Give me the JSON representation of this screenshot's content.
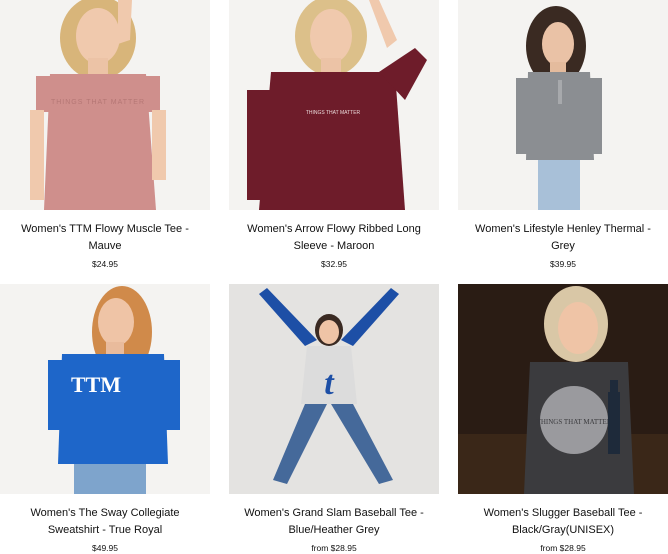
{
  "products": [
    {
      "title": "Women's TTM Flowy Muscle Tee - Mauve",
      "price": "$24.95",
      "shirt_color": "#cf8f8c",
      "shirt_print": "THINGS THAT MATTER",
      "bg": "#f3f2f0"
    },
    {
      "title": "Women's Arrow Flowy Ribbed Long Sleeve - Maroon",
      "price": "$32.95",
      "shirt_color": "#6e1c2a",
      "shirt_print": "THINGS THAT MATTER",
      "bg": "#f3f2f0"
    },
    {
      "title": "Women's Lifestyle Henley Thermal - Grey",
      "price": "$39.95",
      "shirt_color": "#8b8e92",
      "shirt_print": "",
      "bg": "#f3f2f0"
    },
    {
      "title": "Women's The Sway Collegiate Sweatshirt - True Royal",
      "price": "$49.95",
      "shirt_color": "#1e66c9",
      "shirt_print": "TTM",
      "bg": "#f3f2f0"
    },
    {
      "title": "Women's Grand Slam Baseball Tee - Blue/Heather Grey",
      "price": "from $28.95",
      "shirt_color": "#1d4fa6",
      "shirt_print": "t",
      "bg": "#e4e3e1"
    },
    {
      "title": "Women's Slugger Baseball Tee - Black/Gray(UNISEX)",
      "price": "from $28.95",
      "shirt_color": "#3b3b3e",
      "shirt_print": "THINGS THAT MATTER",
      "bg": "#2a1c14"
    }
  ]
}
